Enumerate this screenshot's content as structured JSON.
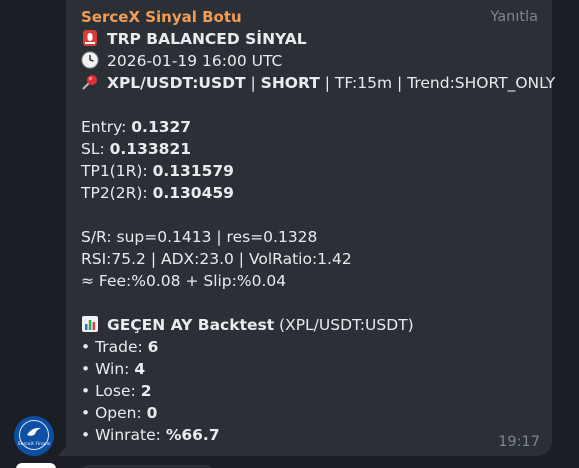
{
  "message": {
    "sender": "SerceX Sinyal Botu",
    "reply_label": "Yanıtla",
    "time": "19:17",
    "title_emoji": "🚨",
    "title": "TRP BALANCED SİNYAL",
    "datetime_emoji": "🕒",
    "datetime": "2026-01-19 16:00 UTC",
    "pair_emoji": "📌",
    "pair": "XPL/USDT:USDT",
    "separator1": " | ",
    "direction": "SHORT",
    "meta": " | TF:15m | Trend:SHORT_ONLY",
    "entry_label": "Entry: ",
    "entry_value": "0.1327",
    "sl_label": "SL: ",
    "sl_value": "0.133821",
    "tp1_label": "TP1(1R): ",
    "tp1_value": "0.131579",
    "tp2_label": "TP2(2R): ",
    "tp2_value": "0.130459",
    "sr_line": "S/R: sup=0.1413 | res=0.1328",
    "indicators_line": "RSI:75.2 | ADX:23.0 | VolRatio:1.42",
    "fee_line": "≈ Fee:%0.08 + Slip:%0.04",
    "backtest_emoji": "📊",
    "backtest_title": "GEÇEN AY Backtest",
    "backtest_pair": " (XPL/USDT:USDT)",
    "stats": [
      {
        "label": "• Trade: ",
        "value": "6"
      },
      {
        "label": "• Win: ",
        "value": "4"
      },
      {
        "label": "• Lose: ",
        "value": "2"
      },
      {
        "label": "• Open: ",
        "value": "0"
      },
      {
        "label": "• Winrate: ",
        "value": "%66.7"
      }
    ]
  },
  "avatar": {
    "text": "SerceX Finans"
  },
  "colors": {
    "background": "#1b1e24",
    "bubble": "#2b2f36",
    "sender": "#f39c54",
    "text": "#e9ebee",
    "muted": "#7d8590",
    "avatar": "#0d4fa3"
  }
}
